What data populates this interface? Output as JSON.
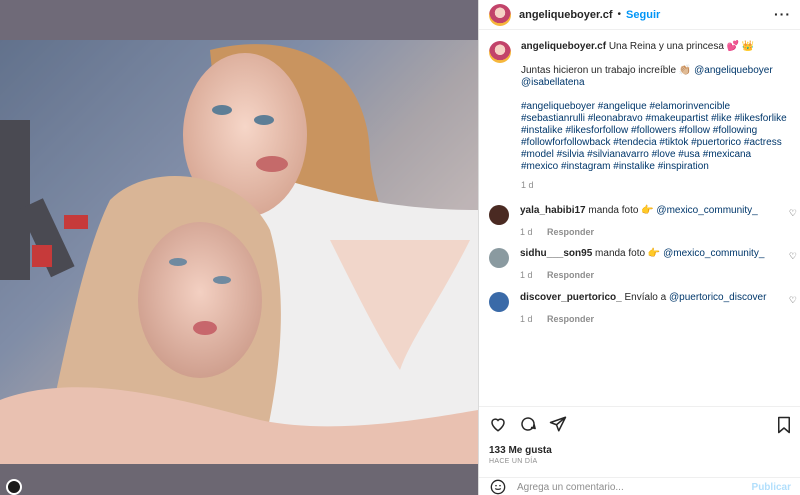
{
  "post": {
    "username": "angeliqueboyer.cf",
    "follow_label": "Seguir",
    "dot": "•",
    "more_label": "···"
  },
  "caption": {
    "username": "angeliqueboyer.cf",
    "title": "Una Reina y una princesa 💕 👑",
    "line2_prefix": "Juntas hicieron un trabajo increíble 👏🏼",
    "mention1": "@angeliqueboyer",
    "mention2": "@isabellatena",
    "hashtags": "#angeliqueboyer #angelique #elamorinvencible #sebastianrulli #leonabravo #makeupartist #like #likesforlike #instalike #likesforfollow #followers #follow #following #followforfollowback #tendecia #tiktok #puertorico #actress #model #silvia #silvianavarro #love #usa #mexicana #mexico #instagram #instalike #inspiration",
    "time": "1 d"
  },
  "comments": [
    {
      "username": "yala_habibi17",
      "text": "manda foto 👉",
      "mention": "@mexico_community_",
      "time": "1 d",
      "reply": "Responder",
      "avatar_color": "#4a2a22"
    },
    {
      "username": "sidhu___son95",
      "text": "manda foto 👉",
      "mention": "@mexico_community_",
      "time": "1 d",
      "reply": "Responder",
      "avatar_color": "#8a9aa0"
    },
    {
      "username": "discover_puertorico_",
      "text": "Envíalo a",
      "mention": "@puertorico_discover",
      "time": "1 d",
      "reply": "Responder",
      "avatar_color": "#3a6aa8"
    }
  ],
  "actions": {
    "likes": "133 Me gusta",
    "ago": "HACE UN DÍA",
    "comment_placeholder": "Agrega un comentario...",
    "publish_label": "Publicar"
  }
}
